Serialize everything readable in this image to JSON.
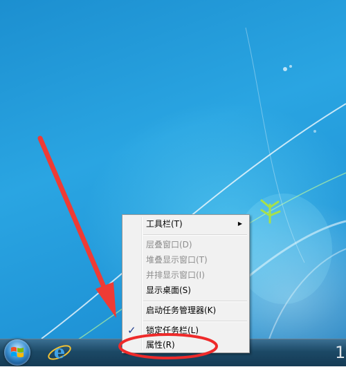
{
  "taskbar": {
    "start_icon": "windows-logo-icon",
    "pinned_app_icon": "internet-explorer-icon",
    "tray_glyph": "1"
  },
  "context_menu": {
    "items": [
      {
        "label": "工具栏(T)",
        "enabled": true,
        "submenu": true
      },
      {
        "label": "层叠窗口(D)",
        "enabled": false
      },
      {
        "label": "堆叠显示窗口(T)",
        "enabled": false
      },
      {
        "label": "并排显示窗口(I)",
        "enabled": false
      },
      {
        "label": "显示桌面(S)",
        "enabled": true
      },
      {
        "label": "启动任务管理器(K)",
        "enabled": true
      },
      {
        "label": "锁定任务栏(L)",
        "enabled": true,
        "checked": true
      },
      {
        "label": "属性(R)",
        "enabled": true
      }
    ],
    "check_glyph": "✓",
    "submenu_glyph": "▶"
  },
  "annotations": {
    "arrow_color": "#ee3b35",
    "highlight_ellipse_color": "#ee2a2a",
    "highlighted_item": "属性(R)"
  },
  "colors": {
    "desktop_blue": "#2aa5e2",
    "taskbar": "#1c4966",
    "menu_bg": "#f1f1f1"
  }
}
